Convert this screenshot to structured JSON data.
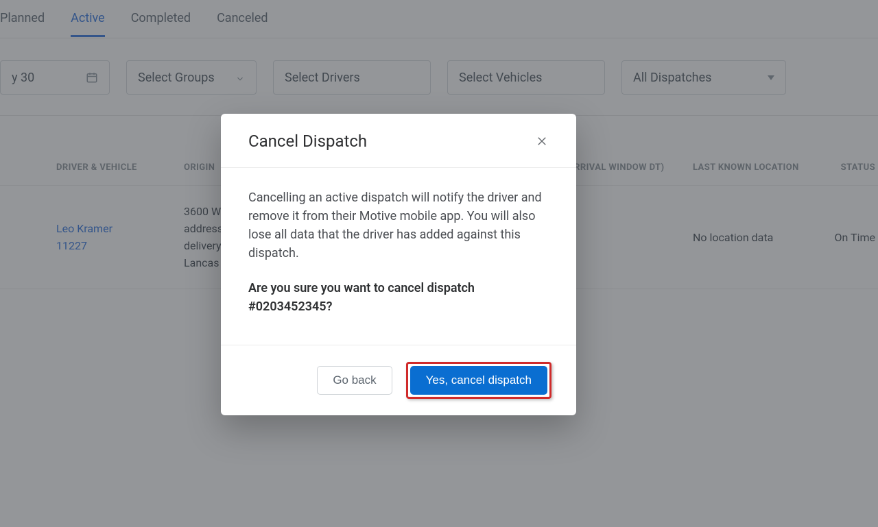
{
  "tabs": {
    "planned": "Planned",
    "active": "Active",
    "completed": "Completed",
    "canceled": "Canceled"
  },
  "filters": {
    "date": "y 30",
    "groups": "Select Groups",
    "drivers": "Select Drivers",
    "vehicles": "Select Vehicles",
    "dispatches": "All Dispatches"
  },
  "table": {
    "headers": {
      "driver": "DRIVER & VEHICLE",
      "origin": "ORIGIN",
      "arrival": "ARRIVAL WINDOW DT)",
      "location": "LAST KNOWN LOCATION",
      "status": "STATUS"
    },
    "rows": [
      {
        "driver": "Leo Kramer",
        "vehicle": "11227",
        "origin_l1": "3600 W",
        "origin_l2": "address",
        "origin_l3": "delivery",
        "origin_l4": "Lancas",
        "location": "No location data",
        "status": "On Time"
      }
    ]
  },
  "modal": {
    "title": "Cancel Dispatch",
    "body": "Cancelling an active dispatch will notify the driver and remove it from their Motive mobile app. You will also lose all data that the driver has added against this dispatch.",
    "confirm": "Are you sure you want to cancel dispatch #0203452345?",
    "go_back": "Go back",
    "confirm_btn": "Yes, cancel dispatch"
  }
}
